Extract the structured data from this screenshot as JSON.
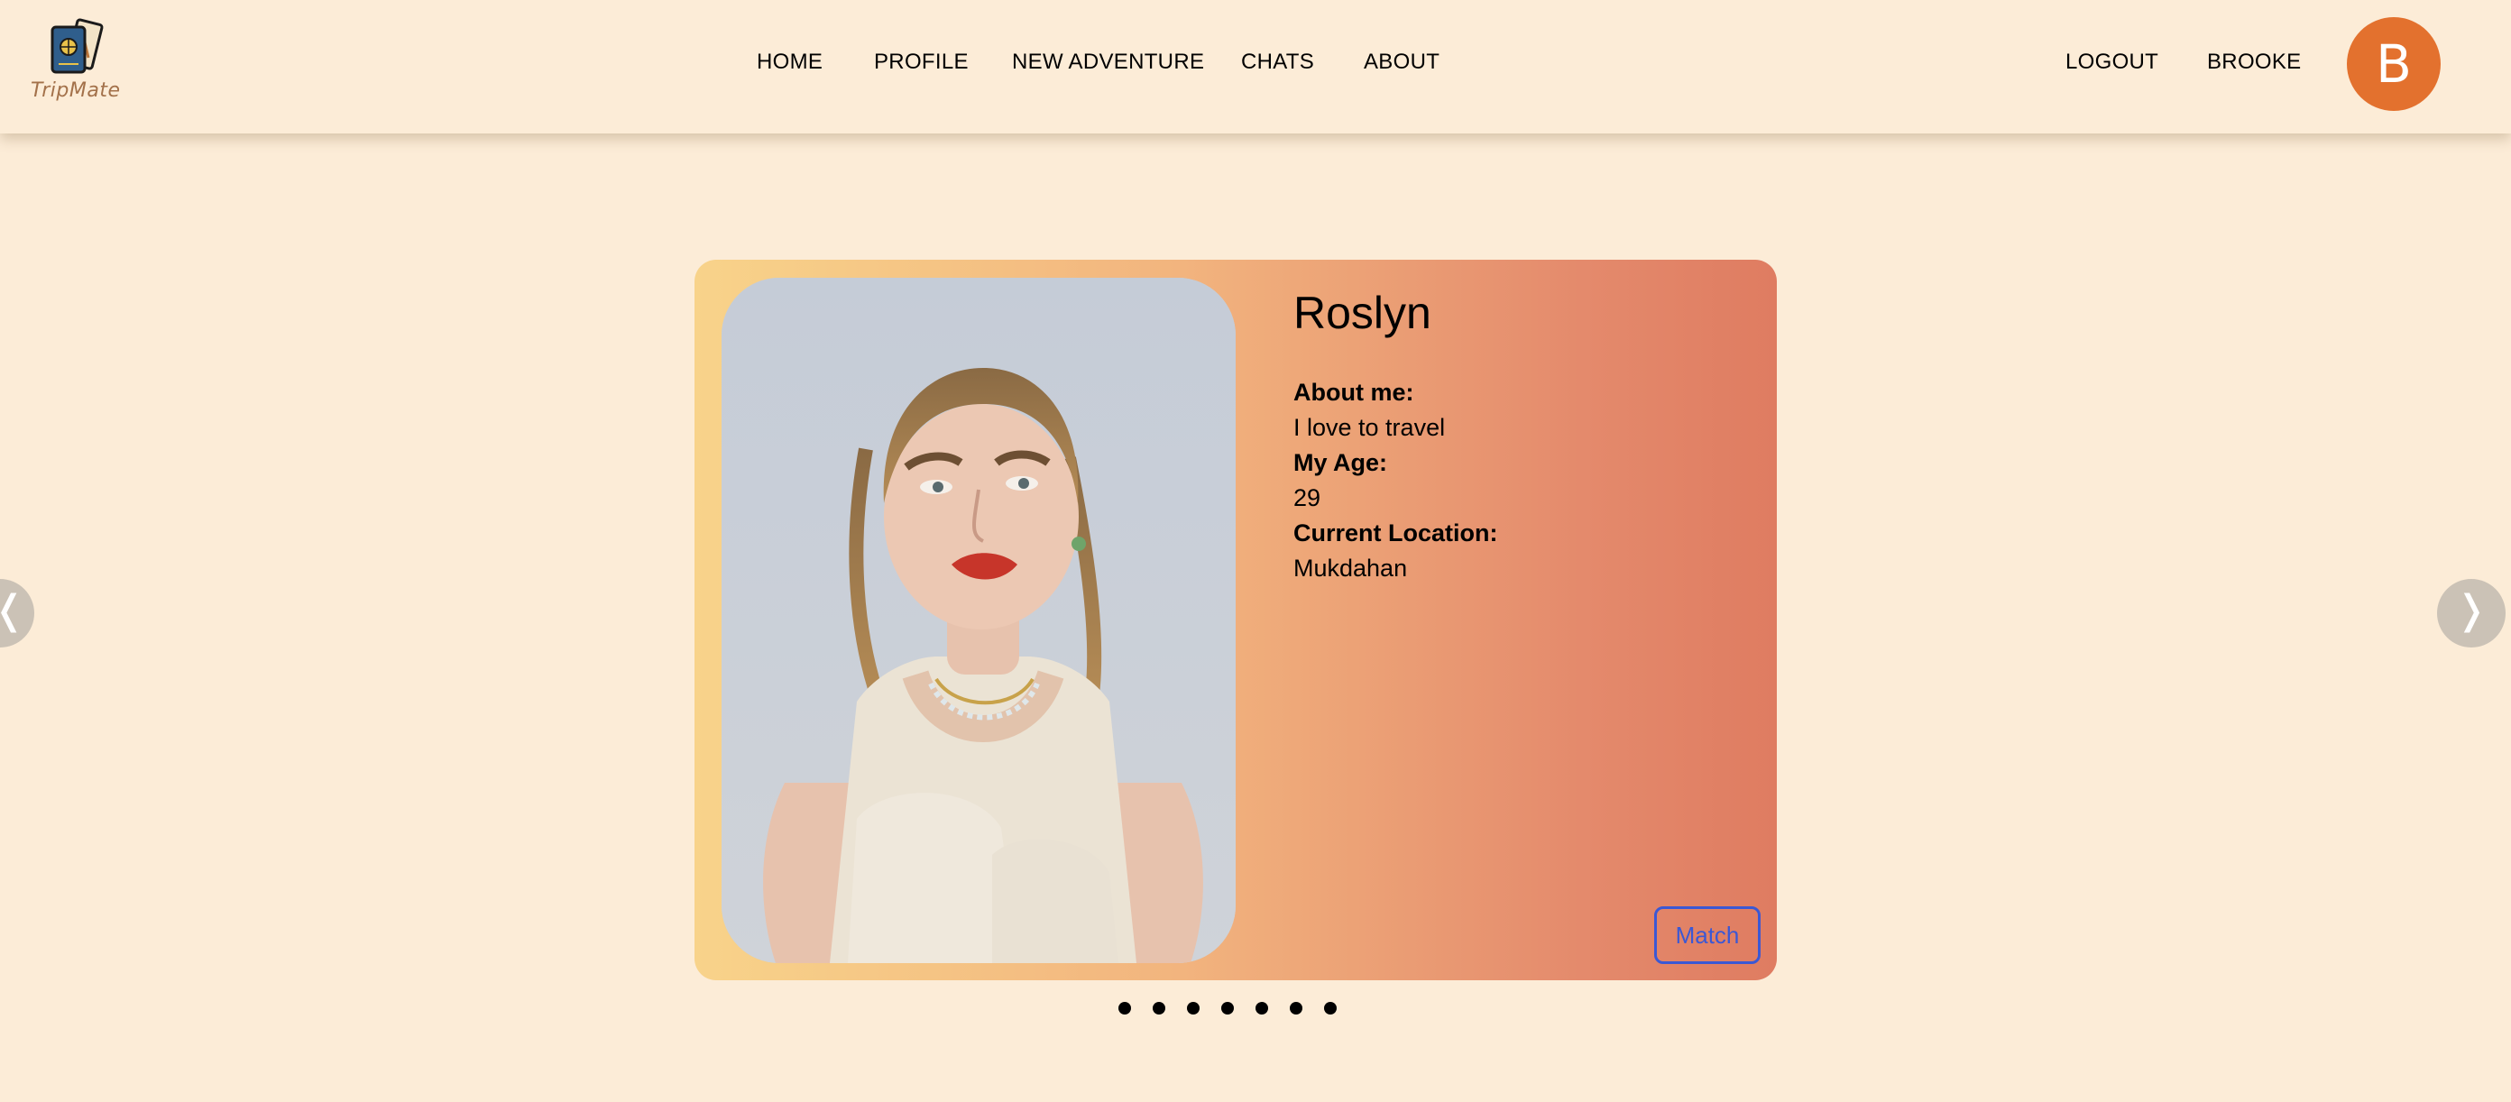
{
  "app": {
    "name": "TripMate",
    "logo_icon": "passport-tickets-icon"
  },
  "nav": {
    "items": [
      {
        "label": "HOME"
      },
      {
        "label": "PROFILE"
      },
      {
        "label": "NEW ADVENTURE"
      },
      {
        "label": "CHATS"
      },
      {
        "label": "ABOUT"
      }
    ],
    "logout_label": "LOGOUT",
    "username": "BROOKE",
    "avatar_initial": "B"
  },
  "profile_card": {
    "name": "Roslyn",
    "about_label": "About me:",
    "about_value": "I love to travel",
    "age_label": "My Age:",
    "age_value": "29",
    "location_label": "Current Location:",
    "location_value": "Mukdahan",
    "match_label": "Match",
    "photo_icon": "profile-photo"
  },
  "carousel": {
    "prev_icon": "chevron-left-icon",
    "prev_glyph": "❬",
    "next_icon": "chevron-right-icon",
    "next_glyph": "❭",
    "slide_count": 7
  },
  "colors": {
    "background": "#fcecd7",
    "avatar": "#e3712e",
    "match_button": "#3b58d4",
    "card_gradient_start": "#f8d38a",
    "card_gradient_end": "#df7c61"
  }
}
